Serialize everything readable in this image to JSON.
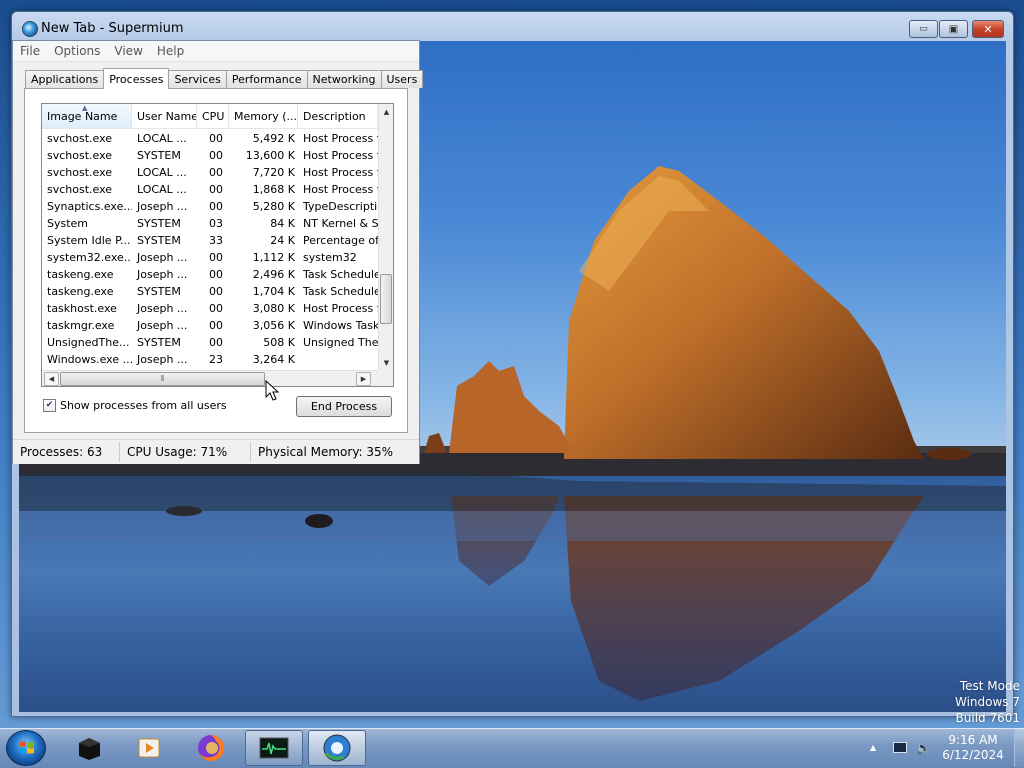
{
  "browser": {
    "title": "New Tab - Supermium",
    "minimize_glyph": "▭",
    "maximize_glyph": "▣",
    "close_glyph": "✕"
  },
  "taskmgr": {
    "menu": [
      "File",
      "Options",
      "View",
      "Help"
    ],
    "tabs": [
      "Applications",
      "Processes",
      "Services",
      "Performance",
      "Networking",
      "Users"
    ],
    "active_tab": "Processes",
    "columns": [
      "Image Name",
      "User Name",
      "CPU",
      "Memory (...",
      "Description"
    ],
    "rows": [
      [
        "svchost.exe",
        "LOCAL ...",
        "00",
        "5,492 K",
        "Host Process f"
      ],
      [
        "svchost.exe",
        "SYSTEM",
        "00",
        "13,600 K",
        "Host Process f"
      ],
      [
        "svchost.exe",
        "LOCAL ...",
        "00",
        "7,720 K",
        "Host Process f"
      ],
      [
        "svchost.exe",
        "LOCAL ...",
        "00",
        "1,868 K",
        "Host Process f"
      ],
      [
        "Synaptics.exe...",
        "Joseph ...",
        "00",
        "5,280 K",
        "TypeDescriptio"
      ],
      [
        "System",
        "SYSTEM",
        "03",
        "84 K",
        "NT Kernel & Sy"
      ],
      [
        "System Idle P...",
        "SYSTEM",
        "33",
        "24 K",
        "Percentage of"
      ],
      [
        "system32.exe...",
        "Joseph ...",
        "00",
        "1,112 K",
        "system32"
      ],
      [
        "taskeng.exe",
        "Joseph ...",
        "00",
        "2,496 K",
        "Task Schedule"
      ],
      [
        "taskeng.exe",
        "SYSTEM",
        "00",
        "1,704 K",
        "Task Schedule"
      ],
      [
        "taskhost.exe",
        "Joseph ...",
        "00",
        "3,080 K",
        "Host Process f"
      ],
      [
        "taskmgr.exe",
        "Joseph ...",
        "00",
        "3,056 K",
        "Windows Task"
      ],
      [
        "UnsignedThe...",
        "SYSTEM",
        "00",
        "508 K",
        "Unsigned Ther"
      ],
      [
        "Windows.exe ...",
        "Joseph ...",
        "23",
        "3,264 K",
        ""
      ]
    ],
    "show_all_label": "Show processes from all users",
    "show_all_checked": true,
    "end_process_label": "End Process",
    "status": {
      "processes": "Processes: 63",
      "cpu": "CPU Usage: 71%",
      "memory": "Physical Memory: 35%"
    }
  },
  "watermark": {
    "line1": "Test Mode",
    "line2": "Windows 7",
    "line3": "Build 7601"
  },
  "taskbar": {
    "items": [
      {
        "name": "start-orb-icon"
      },
      {
        "name": "black-box-app-icon"
      },
      {
        "name": "media-player-icon"
      },
      {
        "name": "firefox-icon"
      },
      {
        "name": "task-manager-icon"
      },
      {
        "name": "supermium-icon"
      }
    ],
    "tray": {
      "clock_time": "9:16 AM",
      "clock_date": "6/12/2024"
    }
  }
}
